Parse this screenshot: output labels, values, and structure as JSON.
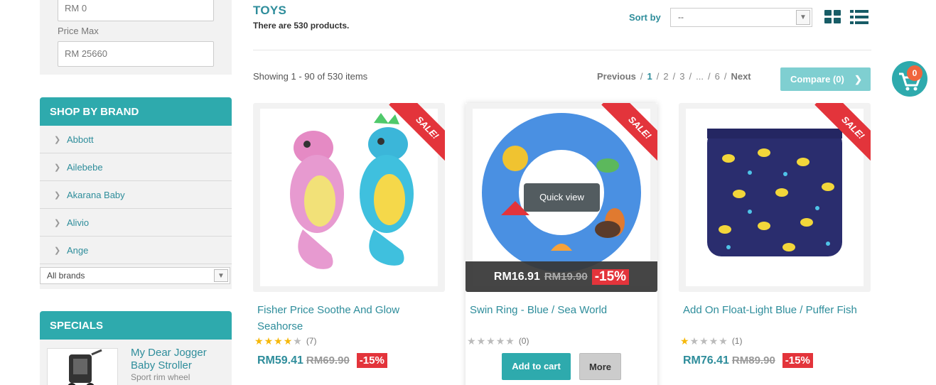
{
  "filters": {
    "price_min_value": "RM  0",
    "price_max_label": "Price Max",
    "price_max_value": "RM  25660"
  },
  "brands": {
    "title": "SHOP BY BRAND",
    "items": [
      "Abbott",
      "Ailebebe",
      "Akarana Baby",
      "Alivio",
      "Ange"
    ],
    "select_value": "All brands"
  },
  "specials": {
    "title": "SPECIALS",
    "item_name": "My Dear Jogger Baby Stroller",
    "item_desc": "Sport rim wheel"
  },
  "category": {
    "title": "TOYS",
    "count": "There are 530 products."
  },
  "sort": {
    "label": "Sort by",
    "value": "--"
  },
  "listing": {
    "showing": "Showing 1 - 90 of 530 items",
    "pager": {
      "prev": "Previous",
      "pages": [
        "1",
        "2",
        "3",
        "...",
        "6"
      ],
      "current": "1",
      "next": "Next",
      "sep": "/"
    },
    "compare": "Compare (0)"
  },
  "cart": {
    "count": "0"
  },
  "products": [
    {
      "name": "Fisher Price Soothe And Glow Seahorse",
      "badge": "SALE!",
      "rating": 4,
      "reviews": "(7)",
      "price": "RM59.41",
      "old_price": "RM69.90",
      "discount": "-15%"
    },
    {
      "name": "Swin Ring - Blue / Sea World",
      "badge": "SALE!",
      "rating": 0,
      "reviews": "(0)",
      "price": "RM16.91",
      "old_price": "RM19.90",
      "discount": "-15%",
      "quickview": "Quick view",
      "add_to_cart": "Add to cart",
      "more": "More"
    },
    {
      "name": "Add On Float-Light Blue / Puffer Fish",
      "badge": "SALE!",
      "rating": 1,
      "reviews": "(1)",
      "price": "RM76.41",
      "old_price": "RM89.90",
      "discount": "-15%"
    }
  ],
  "colors": {
    "accent": "#2eaaad",
    "sale": "#e3343b",
    "link": "#2e8d9b"
  }
}
